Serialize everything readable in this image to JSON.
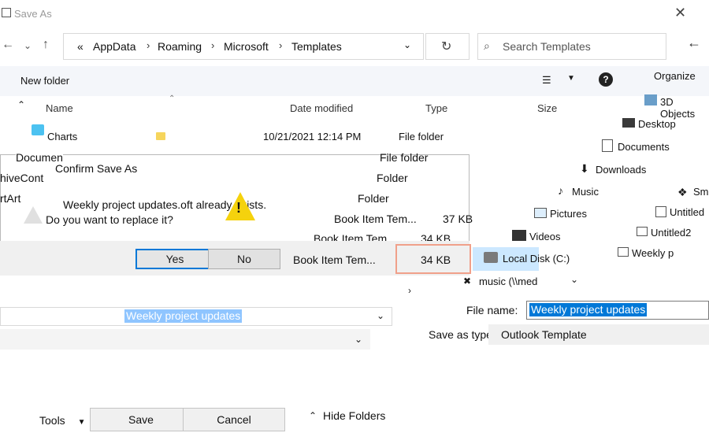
{
  "window": {
    "title": "Save As"
  },
  "nav": {
    "back": "←",
    "forward": "→",
    "up": "↑",
    "breadcrumbs": [
      "AppData",
      "Roaming",
      "Microsoft",
      "Templates"
    ],
    "overflow": "«",
    "refresh": "↻",
    "search_placeholder": "Search Templates",
    "back_right": "←"
  },
  "commandbar": {
    "new_folder": "New folder",
    "organize": "Organize"
  },
  "columns": {
    "name": "Name",
    "date": "Date modified",
    "type": "Type",
    "size": "Size"
  },
  "files": [
    {
      "name": "Charts",
      "date": "10/21/2021 12:14 PM",
      "type": "File folder",
      "size": ""
    },
    {
      "name": "Documen",
      "date": "",
      "type": "File folder",
      "size": ""
    },
    {
      "name": "hiveCont",
      "date": "",
      "type": "Folder",
      "size": ""
    },
    {
      "name": "rtArt",
      "date": "",
      "type": "Folder",
      "size": ""
    },
    {
      "name": "",
      "date": "",
      "type": "Book Item Tem...",
      "size": "37 KB"
    },
    {
      "name": "",
      "date": "",
      "type": "Book Item Tem...",
      "size": "34 KB"
    },
    {
      "name": "",
      "date": "",
      "type": "Book Item Tem...",
      "size": "34 KB"
    }
  ],
  "navpane": {
    "items": [
      "3D Objects",
      "Desktop",
      "Documents",
      "Downloads",
      "Music",
      "Pictures",
      "Videos",
      "Local Disk (C:)",
      "music (\\\\med"
    ],
    "right_items": [
      "Sm",
      "Untitled",
      "Untitled2",
      "Weekly p"
    ]
  },
  "form": {
    "file_name_label": "File name:",
    "file_name_value": "Weekly project updates",
    "save_type_label": "Save as type:",
    "save_type_value": "Outlook Template",
    "ghost_file_name": "Weekly project updates"
  },
  "footer": {
    "tools": "Tools",
    "save": "Save",
    "cancel": "Cancel",
    "hide_folders": "Hide Folders"
  },
  "dialog": {
    "title": "Confirm Save As",
    "message1": "Weekly project updates.oft already exists.",
    "message2": "Do you want to replace it?",
    "yes": "Yes",
    "no": "No"
  },
  "colors": {
    "accent": "#0078d7",
    "folder": "#f6d55c",
    "warning": "#f5d20d",
    "highlight": "#f0a08a"
  }
}
